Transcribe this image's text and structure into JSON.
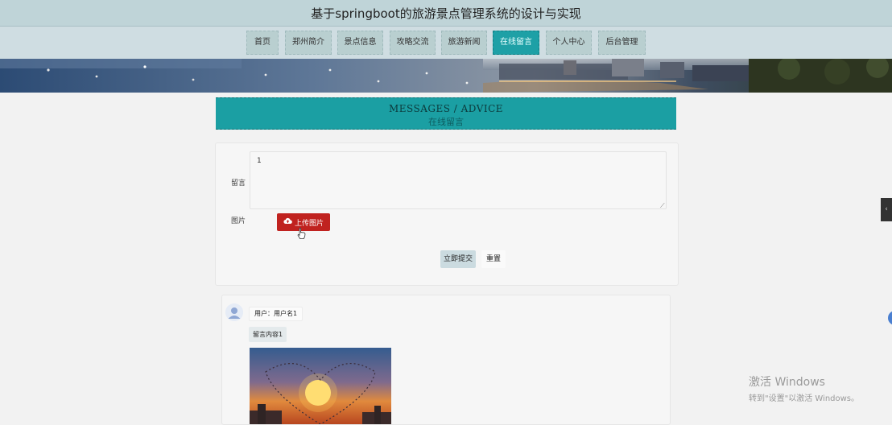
{
  "site": {
    "title": "基于springboot的旅游景点管理系统的设计与实现"
  },
  "nav": {
    "items": [
      {
        "label": "首页"
      },
      {
        "label": "郑州简介"
      },
      {
        "label": "景点信息"
      },
      {
        "label": "攻略交流"
      },
      {
        "label": "旅游新闻"
      },
      {
        "label": "在线留言"
      },
      {
        "label": "个人中心"
      },
      {
        "label": "后台管理"
      }
    ],
    "active_index": 5
  },
  "section": {
    "title_en": "MESSAGES / ADVICE",
    "title_cn": "在线留言"
  },
  "form": {
    "message_label": "留言",
    "message_value": "1",
    "image_label": "图片",
    "upload_label": "上传图片",
    "submit_label": "立即提交",
    "reset_label": "重置"
  },
  "messages": [
    {
      "user": "用户：用户名1",
      "content": "留言内容1"
    }
  ],
  "watermark": {
    "title": "激活 Windows",
    "subtitle": "转到\"设置\"以激活 Windows。"
  },
  "colors": {
    "accent": "#1ea0a6",
    "upload": "#c0221f",
    "topbar": "#bfd4d8",
    "nav": "#cfdde2"
  },
  "icons": {
    "upload": "cloud-upload-icon",
    "side_tab": "chevron-left-icon"
  }
}
